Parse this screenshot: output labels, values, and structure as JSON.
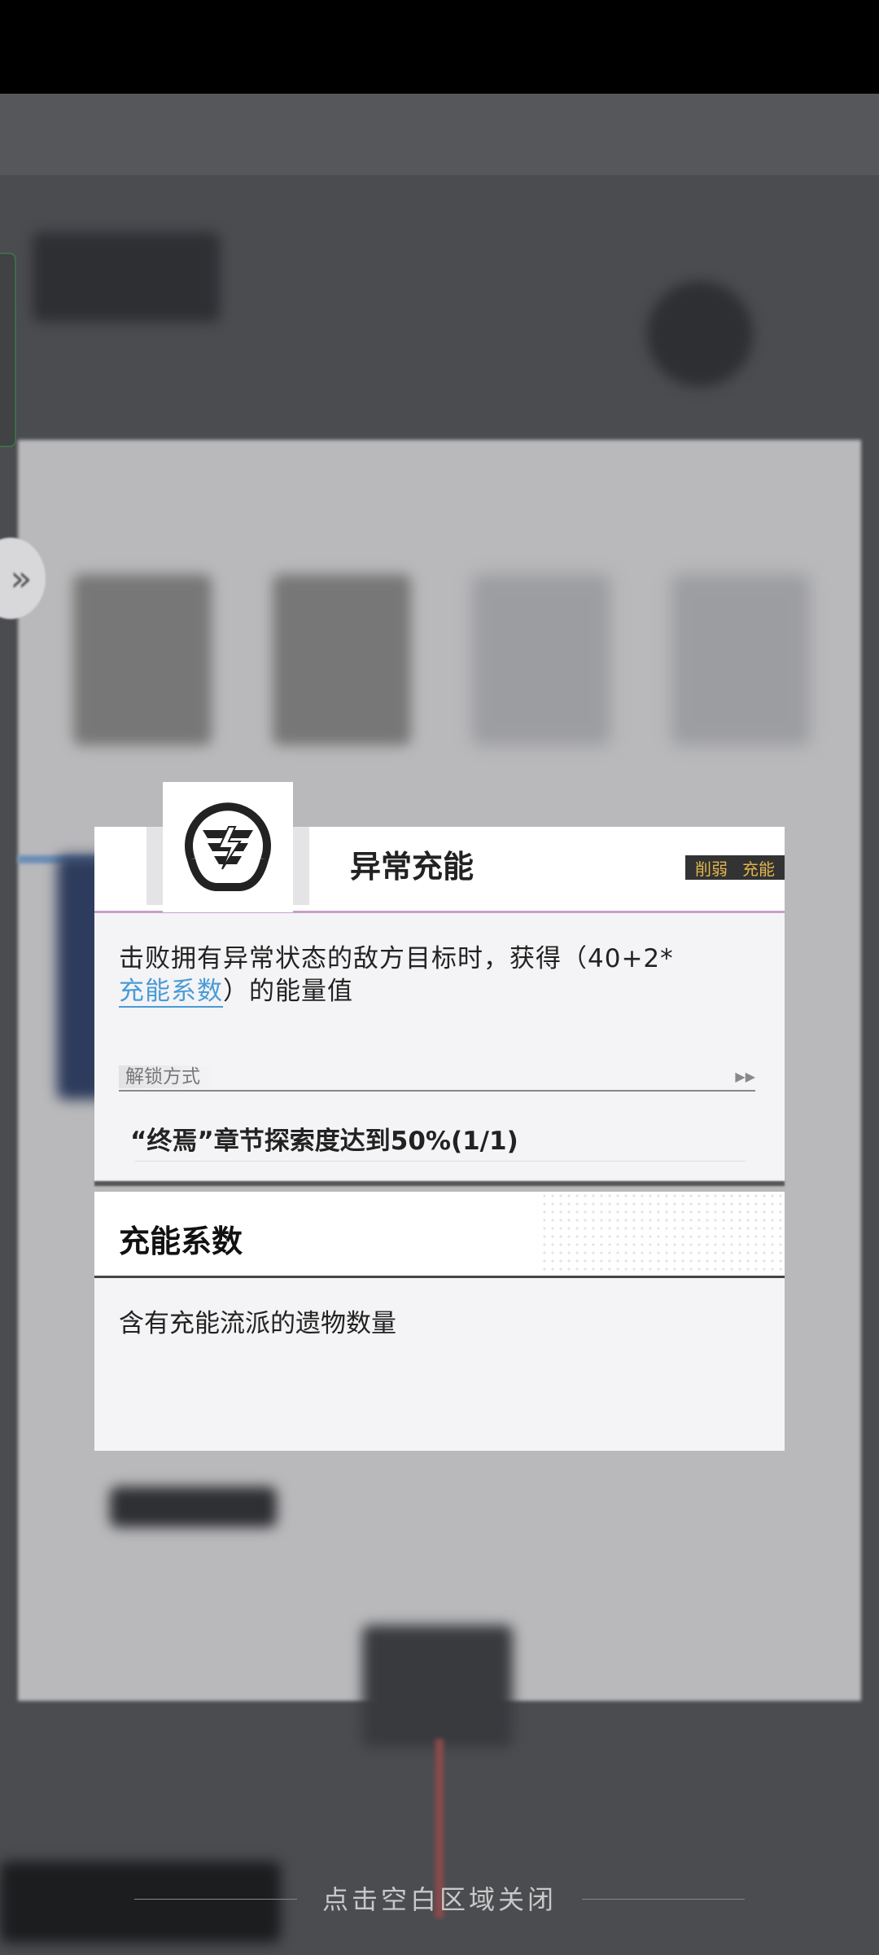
{
  "popup": {
    "title": "异常充能",
    "tags": [
      "削弱",
      "充能"
    ],
    "description_prefix": "击败拥有异常状态的敌方目标时，获得（40+2*",
    "description_link": "充能系数",
    "description_suffix": "）的能量值",
    "unlock_label": "解锁方式",
    "unlock_arrows": "▶▶",
    "unlock_condition": "“终焉”章节探索度达到50%(1/1)",
    "icon": "lightning-badge-icon"
  },
  "term": {
    "title": "充能系数",
    "description": "含有充能流派的遗物数量"
  },
  "footer": {
    "close_hint": "点击空白区域关闭"
  },
  "side": {
    "expand_icon": "double-chevron-right-icon"
  }
}
